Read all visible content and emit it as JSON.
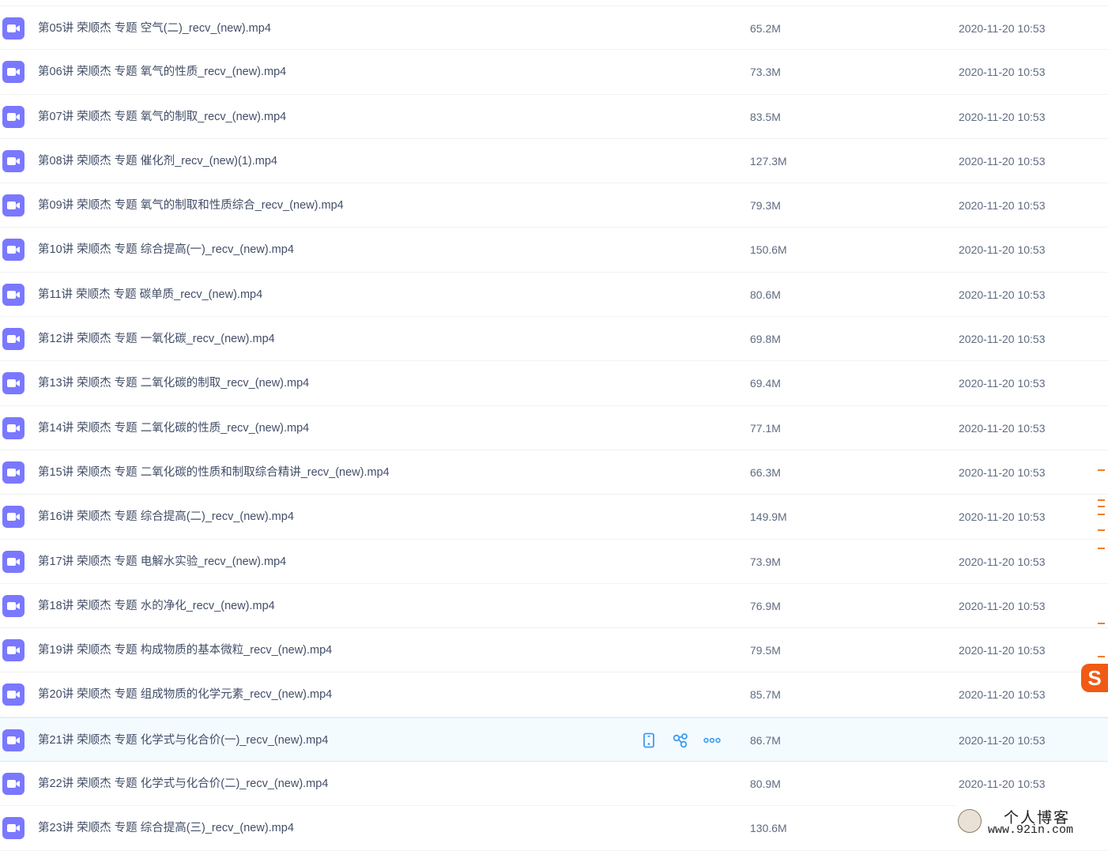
{
  "files": [
    {
      "name": "第05讲 荣顺杰 专题 空气(二)_recv_(new).mp4",
      "size": "65.2M",
      "date": "2020-11-20 10:53"
    },
    {
      "name": "第06讲 荣顺杰 专题 氧气的性质_recv_(new).mp4",
      "size": "73.3M",
      "date": "2020-11-20 10:53"
    },
    {
      "name": "第07讲 荣顺杰 专题 氧气的制取_recv_(new).mp4",
      "size": "83.5M",
      "date": "2020-11-20 10:53"
    },
    {
      "name": "第08讲 荣顺杰 专题 催化剂_recv_(new)(1).mp4",
      "size": "127.3M",
      "date": "2020-11-20 10:53"
    },
    {
      "name": "第09讲 荣顺杰 专题 氧气的制取和性质综合_recv_(new).mp4",
      "size": "79.3M",
      "date": "2020-11-20 10:53"
    },
    {
      "name": "第10讲 荣顺杰 专题 综合提高(一)_recv_(new).mp4",
      "size": "150.6M",
      "date": "2020-11-20 10:53"
    },
    {
      "name": "第11讲 荣顺杰 专题 碳单质_recv_(new).mp4",
      "size": "80.6M",
      "date": "2020-11-20 10:53"
    },
    {
      "name": "第12讲 荣顺杰 专题 一氧化碳_recv_(new).mp4",
      "size": "69.8M",
      "date": "2020-11-20 10:53"
    },
    {
      "name": "第13讲 荣顺杰 专题 二氧化碳的制取_recv_(new).mp4",
      "size": "69.4M",
      "date": "2020-11-20 10:53"
    },
    {
      "name": "第14讲 荣顺杰 专题 二氧化碳的性质_recv_(new).mp4",
      "size": "77.1M",
      "date": "2020-11-20 10:53"
    },
    {
      "name": "第15讲 荣顺杰 专题 二氧化碳的性质和制取综合精讲_recv_(new).mp4",
      "size": "66.3M",
      "date": "2020-11-20 10:53"
    },
    {
      "name": "第16讲 荣顺杰 专题 综合提高(二)_recv_(new).mp4",
      "size": "149.9M",
      "date": "2020-11-20 10:53"
    },
    {
      "name": "第17讲 荣顺杰 专题 电解水实验_recv_(new).mp4",
      "size": "73.9M",
      "date": "2020-11-20 10:53"
    },
    {
      "name": "第18讲 荣顺杰 专题 水的净化_recv_(new).mp4",
      "size": "76.9M",
      "date": "2020-11-20 10:53"
    },
    {
      "name": "第19讲 荣顺杰 专题 构成物质的基本微粒_recv_(new).mp4",
      "size": "79.5M",
      "date": "2020-11-20 10:53"
    },
    {
      "name": "第20讲 荣顺杰 专题 组成物质的化学元素_recv_(new).mp4",
      "size": "85.7M",
      "date": "2020-11-20 10:53"
    },
    {
      "name": "第21讲 荣顺杰 专题 化学式与化合价(一)_recv_(new).mp4",
      "size": "86.7M",
      "date": "2020-11-20 10:53",
      "hovered": true
    },
    {
      "name": "第22讲 荣顺杰 专题 化学式与化合价(二)_recv_(new).mp4",
      "size": "80.9M",
      "date": "2020-11-20 10:53"
    },
    {
      "name": "第23讲 荣顺杰 专题 综合提高(三)_recv_(new).mp4",
      "size": "130.6M",
      "date": ""
    }
  ],
  "icons": {
    "file": "video-file-icon",
    "actions": [
      "phone-icon",
      "share-icon",
      "more-icon"
    ]
  },
  "colors": {
    "file_icon": "#7a78ff",
    "action_icon": "#3b9cf2",
    "hover_row": "#f4fbff",
    "sogou": "#f05a14"
  },
  "sogou": {
    "letter": "S"
  },
  "watermark": {
    "title": "个人博客",
    "url": "www.92in.com"
  }
}
